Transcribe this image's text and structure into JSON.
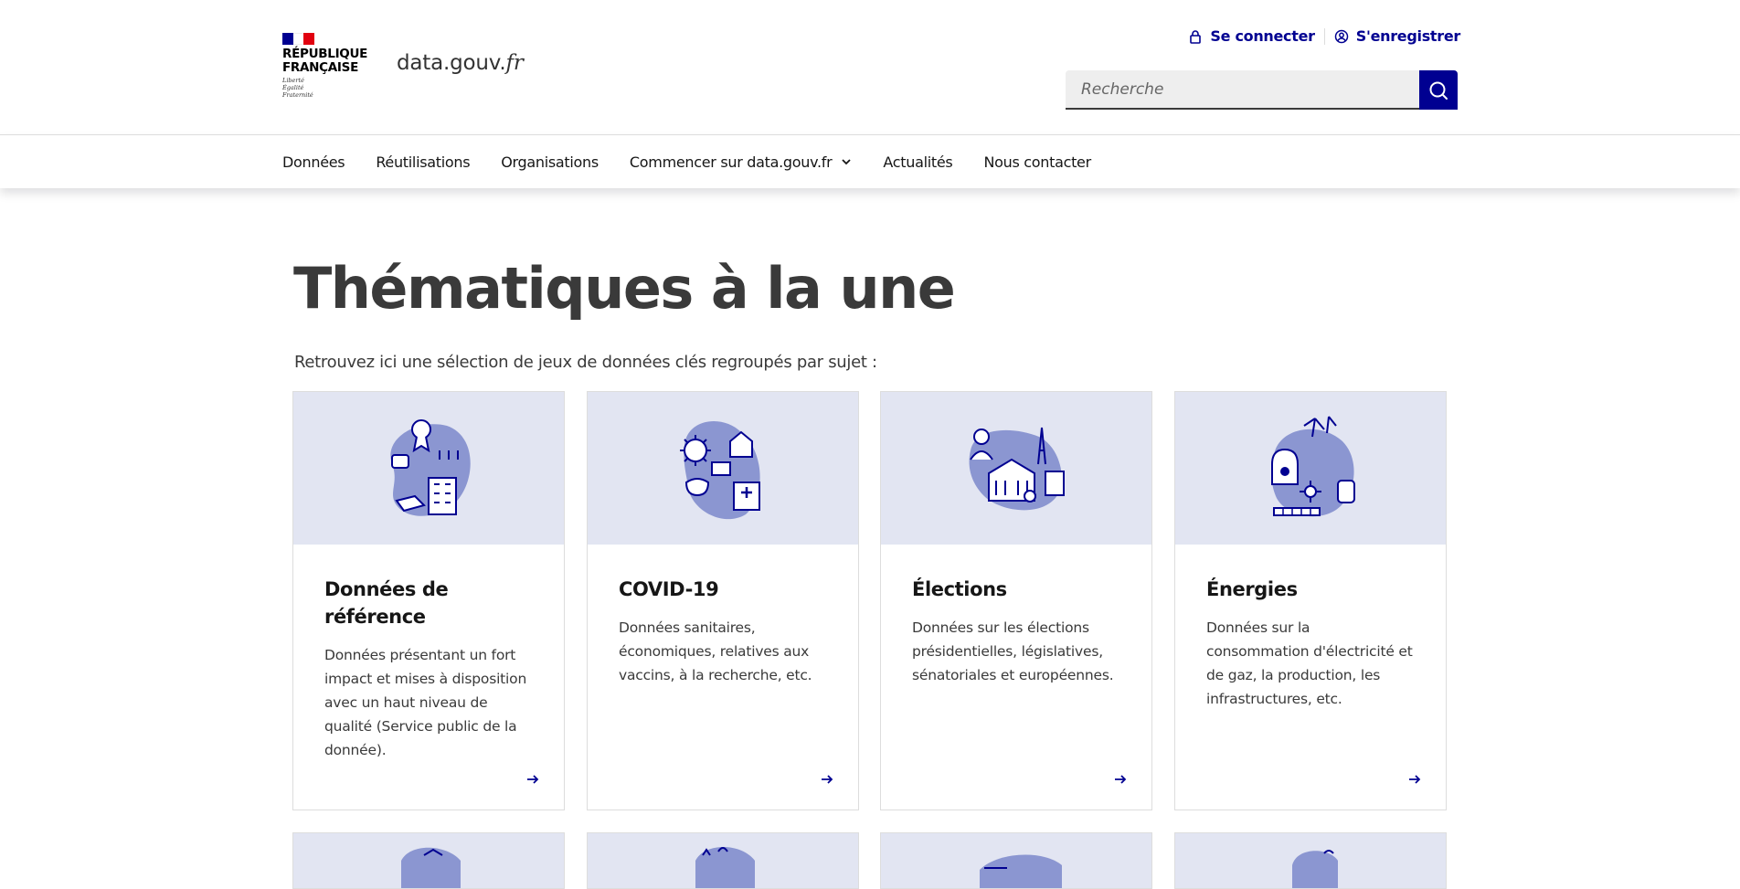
{
  "header": {
    "republic_lines": [
      "RÉPUBLIQUE",
      "FRANÇAISE"
    ],
    "motto_lines": [
      "Liberté",
      "Égalité",
      "Fraternité"
    ],
    "site_name_main": "data.gouv.",
    "site_name_tld": "fr",
    "login_label": "Se connecter",
    "register_label": "S'enregistrer",
    "search_placeholder": "Recherche",
    "flag_colors": [
      "#000091",
      "#ffffff",
      "#e1000f"
    ]
  },
  "nav": {
    "items": [
      {
        "label": "Données"
      },
      {
        "label": "Réutilisations"
      },
      {
        "label": "Organisations"
      },
      {
        "label": "Commencer sur data.gouv.fr",
        "icon": "chevron-down-icon"
      },
      {
        "label": "Actualités"
      },
      {
        "label": "Nous contacter"
      }
    ]
  },
  "main": {
    "title": "Thématiques à la une",
    "intro": "Retrouvez ici une sélection de jeux de données clés regroupés par sujet :",
    "cards": [
      {
        "title": "Données de référence",
        "description": "Données présentant un fort impact et mises à disposition avec un haut niveau de qualité (Service public de la donnée).",
        "icon": "reference-data-illustration"
      },
      {
        "title": "COVID-19",
        "description": "Données sanitaires, économiques, relatives aux vaccins, à la recherche, etc.",
        "icon": "covid-illustration"
      },
      {
        "title": "Élections",
        "description": "Données sur les élections présidentielles, législatives, sénatoriales et européennes.",
        "icon": "elections-illustration"
      },
      {
        "title": "Énergies",
        "description": "Données sur la consommation d'électricité et de gaz, la production, les infrastructures, etc.",
        "icon": "energy-illustration"
      }
    ]
  },
  "colors": {
    "accent": "#000091",
    "card_visual_bg": "#e2e5f2",
    "blob": "#8b96d1"
  }
}
